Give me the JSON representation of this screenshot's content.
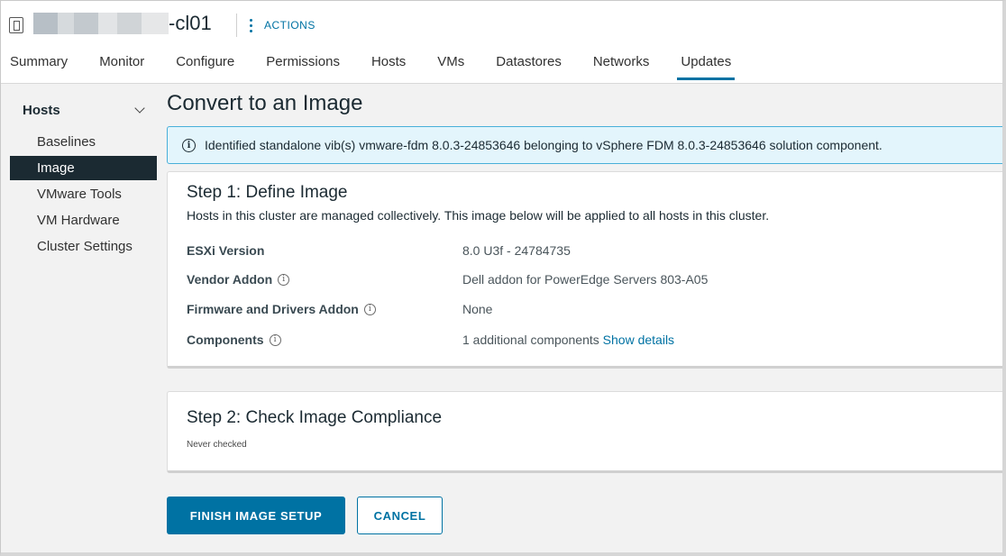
{
  "header": {
    "object_name_suffix": "-cl01",
    "actions_label": "ACTIONS",
    "object_icon": "cluster-icon",
    "actions_icon": "kebab-vertical-icon"
  },
  "tabs": [
    {
      "label": "Summary"
    },
    {
      "label": "Monitor"
    },
    {
      "label": "Configure"
    },
    {
      "label": "Permissions"
    },
    {
      "label": "Hosts"
    },
    {
      "label": "VMs"
    },
    {
      "label": "Datastores"
    },
    {
      "label": "Networks"
    },
    {
      "label": "Updates",
      "active": true
    }
  ],
  "sidebar": {
    "group_label": "Hosts",
    "items": [
      {
        "label": "Baselines"
      },
      {
        "label": "Image",
        "active": true
      },
      {
        "label": "VMware Tools"
      },
      {
        "label": "VM Hardware"
      },
      {
        "label": "Cluster Settings"
      }
    ]
  },
  "main": {
    "title": "Convert to an Image",
    "alert": "Identified standalone vib(s) vmware-fdm 8.0.3-24853646 belonging to vSphere FDM 8.0.3-24853646 solution component.",
    "step1": {
      "title": "Step 1: Define Image",
      "description": "Hosts in this cluster are managed collectively. This image below will be applied to all hosts in this cluster.",
      "props": [
        {
          "label": "ESXi Version",
          "value": "8.0 U3f - 24784735"
        },
        {
          "label": "Vendor Addon",
          "value": "Dell addon for PowerEdge Servers 803-A05"
        },
        {
          "label": "Firmware and Drivers Addon",
          "value": "None"
        },
        {
          "label": "Components",
          "value": "1 additional components",
          "link": "Show details"
        }
      ]
    },
    "step2": {
      "title": "Step 2: Check Image Compliance",
      "status": "Never checked"
    },
    "buttons": {
      "finish": "FINISH IMAGE SETUP",
      "cancel": "CANCEL"
    }
  },
  "colors": {
    "accent": "#0072a3",
    "nav_active_bg": "#1b2a32",
    "alert_bg": "#e3f5fc",
    "alert_border": "#49afd9"
  }
}
